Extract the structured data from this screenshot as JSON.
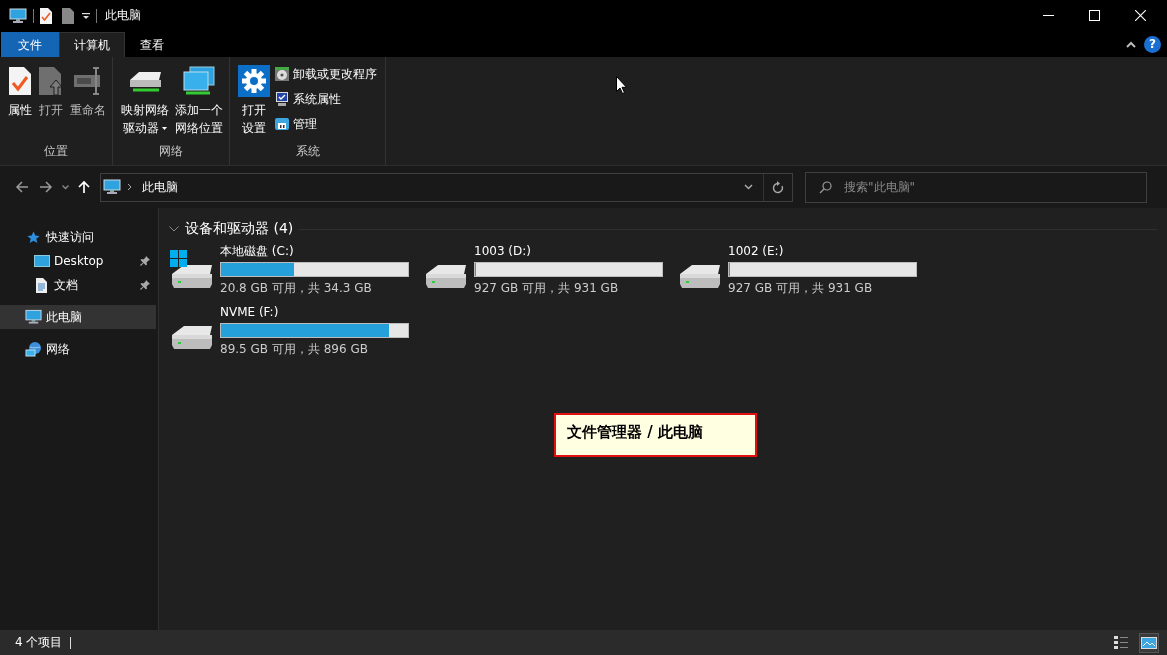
{
  "window": {
    "title": "此电脑"
  },
  "ribbon": {
    "tabs": [
      {
        "label": "文件",
        "kind": "file",
        "selected": false
      },
      {
        "label": "计算机",
        "kind": "tab",
        "selected": true
      },
      {
        "label": "查看",
        "kind": "tab",
        "selected": false
      }
    ],
    "groups": [
      {
        "label": "位置",
        "items": [
          {
            "kind": "large",
            "lines": [
              "属性"
            ],
            "disabled": false,
            "dropdown": false
          },
          {
            "kind": "large",
            "lines": [
              "打开"
            ],
            "disabled": true,
            "dropdown": false
          },
          {
            "kind": "large",
            "lines": [
              "重命名"
            ],
            "disabled": true,
            "dropdown": false
          }
        ]
      },
      {
        "label": "网络",
        "items": [
          {
            "kind": "large",
            "lines": [
              "映射网络",
              "驱动器"
            ],
            "disabled": false,
            "dropdown": true
          },
          {
            "kind": "large",
            "lines": [
              "添加一个",
              "网络位置"
            ],
            "disabled": false,
            "dropdown": false
          }
        ]
      },
      {
        "label": "系统",
        "items": [
          {
            "kind": "large",
            "lines": [
              "打开",
              "设置"
            ],
            "disabled": false,
            "dropdown": false
          },
          {
            "kind": "small",
            "lines": [
              "卸载或更改程序"
            ],
            "disabled": false
          },
          {
            "kind": "small",
            "lines": [
              "系统属性"
            ],
            "disabled": false
          },
          {
            "kind": "small",
            "lines": [
              "管理"
            ],
            "disabled": false
          }
        ]
      }
    ],
    "help": "?"
  },
  "address": {
    "path": [
      "此电脑"
    ],
    "search": {
      "placeholder": "搜索\"此电脑\""
    }
  },
  "sidebar": {
    "items": [
      {
        "label": "快速访问",
        "pinned": false,
        "selected": false,
        "children": [
          {
            "label": "Desktop",
            "pinned": true,
            "selected": false
          },
          {
            "label": "文档",
            "pinned": true,
            "selected": false
          }
        ]
      },
      {
        "label": "此电脑",
        "pinned": false,
        "selected": true
      },
      {
        "label": "网络",
        "pinned": false,
        "selected": false
      }
    ]
  },
  "content": {
    "group": {
      "title": "设备和驱动器 (4)",
      "expanded": true
    },
    "drives": [
      {
        "name": "本地磁盘 (C:)",
        "level": 0.39,
        "reading": "20.8 GB 可用，共 34.3 GB",
        "system": true
      },
      {
        "name": "1003 (D:)",
        "level": 0.004,
        "reading": "927 GB 可用，共 931 GB",
        "system": false
      },
      {
        "name": "1002 (E:)",
        "level": 0.004,
        "reading": "927 GB 可用，共 931 GB",
        "system": false
      },
      {
        "name": "NVME (F:)",
        "level": 0.9,
        "reading": "89.5 GB 可用，共 896 GB",
        "system": false
      }
    ]
  },
  "callout": "文件管理器 / 此电脑",
  "status_bar": {
    "count": "4 个项目",
    "views": [
      {
        "kind": "details",
        "selected": false
      },
      {
        "kind": "large-icons",
        "selected": true
      }
    ]
  }
}
